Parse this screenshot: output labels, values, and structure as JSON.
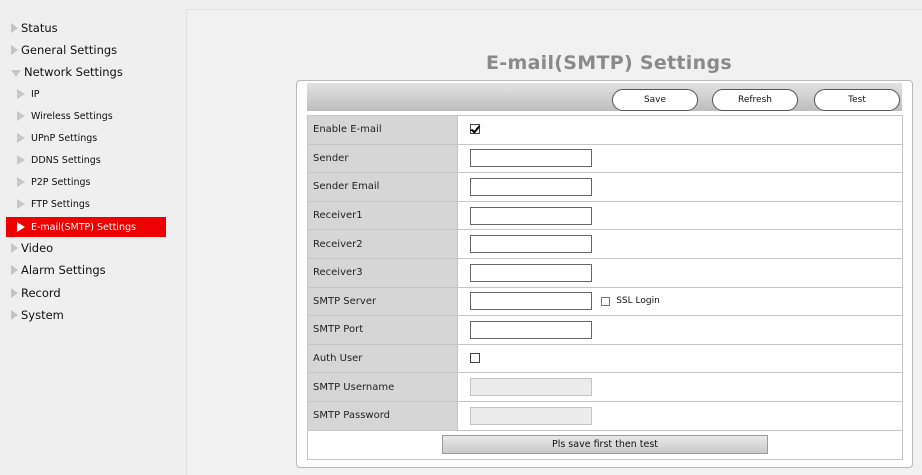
{
  "sidebar": {
    "items": [
      {
        "label": "Status",
        "state": "collapsed"
      },
      {
        "label": "General Settings",
        "state": "collapsed"
      },
      {
        "label": "Network Settings",
        "state": "expanded"
      },
      {
        "label": "IP",
        "state": "sub"
      },
      {
        "label": "Wireless Settings",
        "state": "sub"
      },
      {
        "label": "UPnP Settings",
        "state": "sub"
      },
      {
        "label": "DDNS Settings",
        "state": "sub"
      },
      {
        "label": "P2P Settings",
        "state": "sub"
      },
      {
        "label": "FTP Settings",
        "state": "sub"
      },
      {
        "label": "E-mail(SMTP) Settings",
        "state": "active"
      },
      {
        "label": "Video",
        "state": "collapsed"
      },
      {
        "label": "Alarm Settings",
        "state": "collapsed"
      },
      {
        "label": "Record",
        "state": "collapsed"
      },
      {
        "label": "System",
        "state": "collapsed"
      }
    ],
    "active_color": "#ee0000"
  },
  "page": {
    "title": "E-mail(SMTP) Settings"
  },
  "toolbar": {
    "save_label": "Save",
    "refresh_label": "Refresh",
    "test_label": "Test"
  },
  "form": {
    "enable_email": {
      "label": "Enable E-mail",
      "checked": true
    },
    "sender": {
      "label": "Sender",
      "value": ""
    },
    "sender_email": {
      "label": "Sender Email",
      "value": ""
    },
    "receiver1": {
      "label": "Receiver1",
      "value": ""
    },
    "receiver2": {
      "label": "Receiver2",
      "value": ""
    },
    "receiver3": {
      "label": "Receiver3",
      "value": ""
    },
    "smtp_server": {
      "label": "SMTP Server",
      "value": "",
      "ssl_label": "SSL Login",
      "ssl_checked": false
    },
    "smtp_port": {
      "label": "SMTP Port",
      "value": ""
    },
    "auth_user": {
      "label": "Auth User",
      "checked": false
    },
    "smtp_username": {
      "label": "SMTP Username",
      "value": "",
      "disabled": true
    },
    "smtp_password": {
      "label": "SMTP Password",
      "value": "",
      "disabled": true
    },
    "test_note": "Pls save first then test"
  }
}
